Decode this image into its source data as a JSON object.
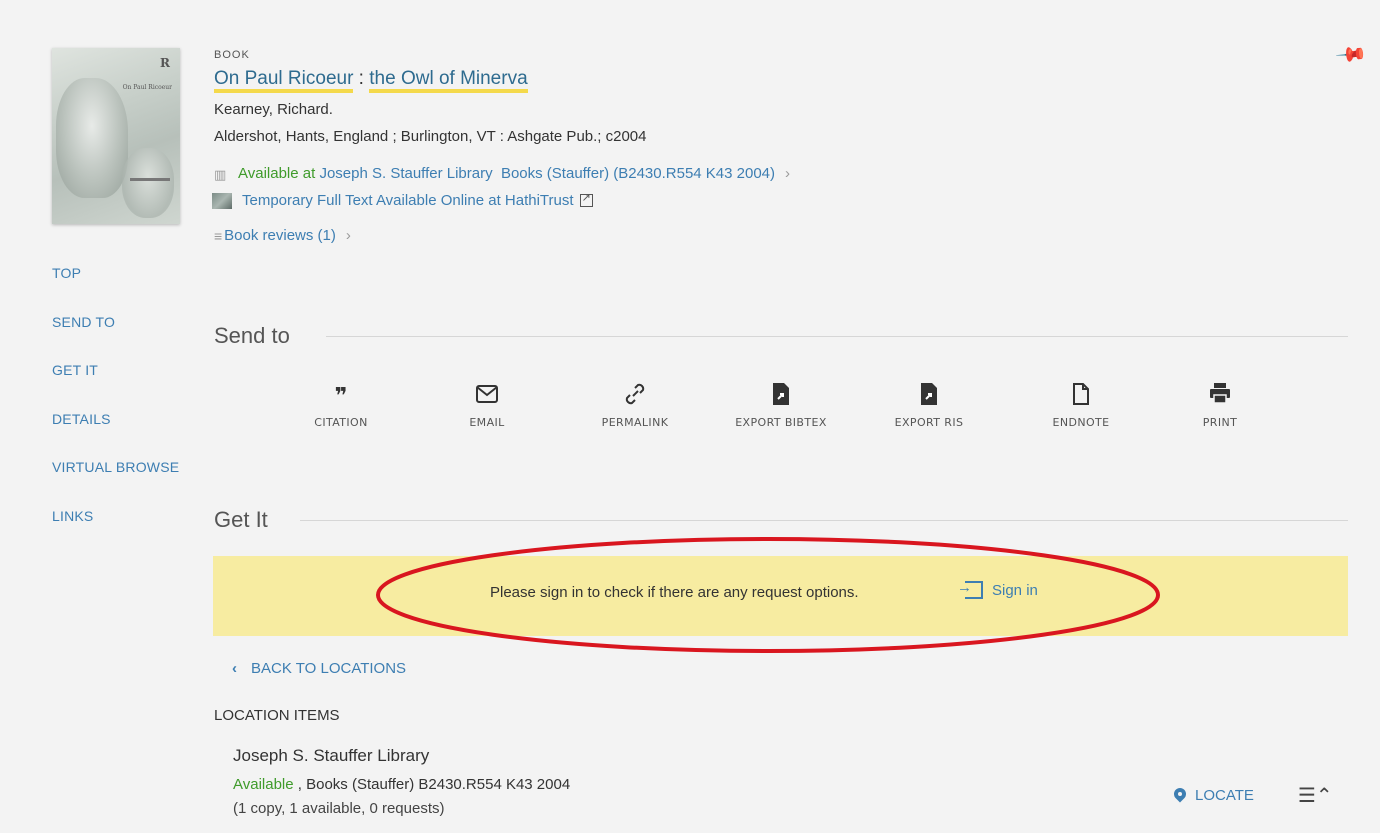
{
  "record": {
    "type": "BOOK",
    "title_part1": "On Paul Ricoeur",
    "title_sep": " : ",
    "title_part2": "the Owl of Minerva",
    "author": "Kearney, Richard.",
    "publication": "Aldershot, Hants, England ; Burlington, VT : Ashgate Pub.; c2004",
    "availability": {
      "status": "Available at",
      "location": "Joseph S. Stauffer Library",
      "details": "Books (Stauffer) (B2430.R554 K43 2004)"
    },
    "online_link": "Temporary Full Text Available Online at HathiTrust",
    "reviews": "Book reviews (1)",
    "cover": {
      "r": "R",
      "title": "On Paul Ricoeur"
    }
  },
  "nav": {
    "items": [
      "TOP",
      "SEND TO",
      "GET IT",
      "DETAILS",
      "VIRTUAL BROWSE",
      "LINKS"
    ]
  },
  "send_to": {
    "heading": "Send to",
    "actions": [
      {
        "label": "CITATION",
        "icon": "quote-icon"
      },
      {
        "label": "EMAIL",
        "icon": "envelope-icon"
      },
      {
        "label": "PERMALINK",
        "icon": "link-icon"
      },
      {
        "label": "EXPORT BIBTEX",
        "icon": "file-export-icon"
      },
      {
        "label": "EXPORT RIS",
        "icon": "file-export-icon"
      },
      {
        "label": "ENDNOTE",
        "icon": "file-icon"
      },
      {
        "label": "PRINT",
        "icon": "printer-icon"
      }
    ]
  },
  "get_it": {
    "heading": "Get It",
    "banner_message": "Please sign in to check if there are any request options.",
    "sign_in": "Sign in",
    "back": "BACK TO LOCATIONS",
    "location_items_heading": "LOCATION ITEMS",
    "location": {
      "name": "Joseph S. Stauffer Library",
      "status": "Available",
      "shelf": " , Books (Stauffer) B2430.R554 K43 2004",
      "copies": "(1 copy, 1 available, 0 requests)"
    },
    "locate": "LOCATE"
  },
  "colors": {
    "link": "#3d7eb2",
    "available": "#3f9b2b",
    "banner": "#f7eca1",
    "annotation": "#d9161f"
  }
}
